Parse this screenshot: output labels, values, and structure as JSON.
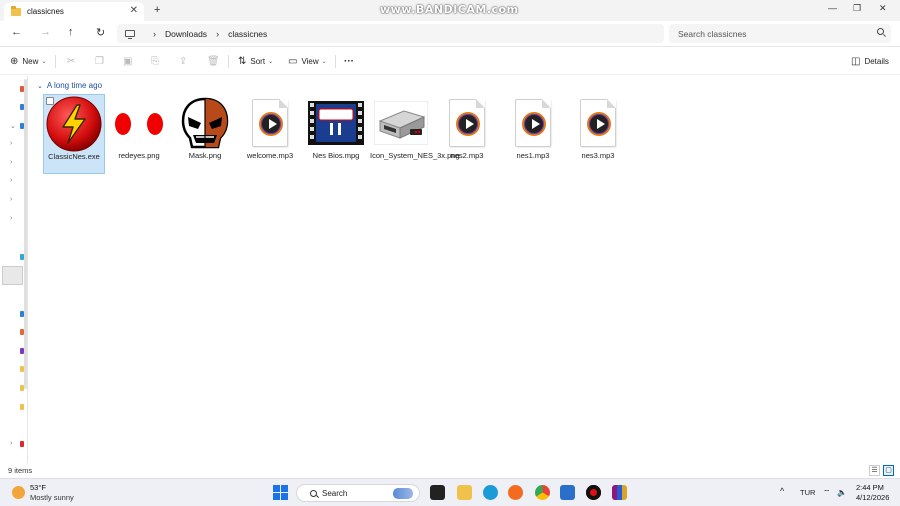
{
  "window": {
    "tab_title": "classicnes",
    "tab_close": "✕",
    "new_tab": "+",
    "watermark": "www.BANDICAM.com",
    "minimize": "—",
    "maximize": "❐",
    "close": "✕"
  },
  "nav": {
    "back": "←",
    "forward": "→",
    "up": "↑",
    "refresh": "↻",
    "breadcrumb": [
      "Downloads",
      "classicnes"
    ],
    "breadcrumb_sep": "›",
    "search_placeholder": "Search classicnes"
  },
  "toolbar": {
    "new_label": "New",
    "sort_label": "Sort",
    "view_label": "View",
    "more_label": "···",
    "details_label": "Details",
    "caret": "⌄"
  },
  "content": {
    "group_header": "A long time ago",
    "group_chevron": "⌄",
    "items": [
      {
        "name": "ClassicNes.exe",
        "kind": "exe",
        "selected": true
      },
      {
        "name": "redeyes.png",
        "kind": "png-redeyes"
      },
      {
        "name": "Mask.png",
        "kind": "png-mask"
      },
      {
        "name": "welcome.mp3",
        "kind": "mp3"
      },
      {
        "name": "Nes Bios.mpg",
        "kind": "mpg"
      },
      {
        "name": "Icon_System_NES_3x.png",
        "kind": "png-nes"
      },
      {
        "name": "nes2.mp3",
        "kind": "mp3"
      },
      {
        "name": "nes1.mp3",
        "kind": "mp3"
      },
      {
        "name": "nes3.mp3",
        "kind": "mp3"
      }
    ]
  },
  "status": {
    "item_count": "9 items"
  },
  "taskbar": {
    "weather_temp": "53°F",
    "weather_desc": "Mostly sunny",
    "search_label": "Search",
    "language": "TUR",
    "time": "2:44 PM",
    "date": "4/12/2026",
    "chevron": "^"
  },
  "colors": {
    "selection_bg": "#cce4f7",
    "accent": "#0067c0",
    "folder": "#f0c24b"
  }
}
